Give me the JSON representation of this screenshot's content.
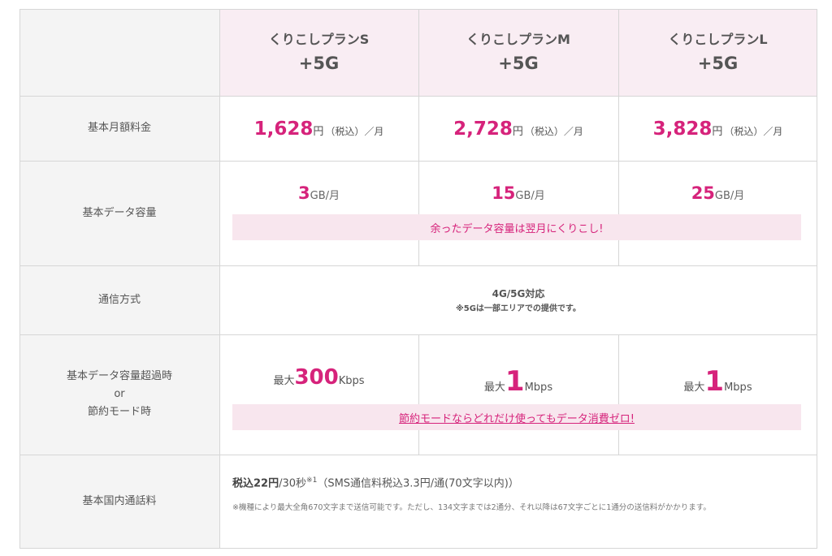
{
  "plans": [
    {
      "name": "くりこしプランS",
      "suffix": "+5G",
      "price": "1,628",
      "data_gb": "3",
      "speed_value": "300",
      "speed_unit": "Kbps"
    },
    {
      "name": "くりこしプランM",
      "suffix": "+5G",
      "price": "2,728",
      "data_gb": "15",
      "speed_value": "1",
      "speed_unit": "Mbps"
    },
    {
      "name": "くりこしプランL",
      "suffix": "+5G",
      "price": "3,828",
      "data_gb": "25",
      "speed_value": "1",
      "speed_unit": "Mbps"
    }
  ],
  "labels": {
    "monthly_fee": "基本月額料金",
    "data_capacity": "基本データ容量",
    "comm_method": "通信方式",
    "over_line1": "基本データ容量超過時",
    "over_line2": "or",
    "over_line3": "節約モード時",
    "call_fee": "基本国内通話料"
  },
  "units": {
    "yen": "円",
    "tax_month": "（税込）／月",
    "gb_month": "GB/月",
    "speed_prefix": "最大"
  },
  "carryover_note": "余ったデータ容量は翌月にくりこし!",
  "comm": {
    "main": "4G/5G対応",
    "note": "※5Gは一部エリアでの提供です。"
  },
  "savings_link": "節約モードならどれだけ使ってもデータ消費ゼロ!",
  "call": {
    "price": "税込22円",
    "per": "/30秒",
    "sup": "※1",
    "sms": "（SMS通信料税込3.3円/通(70文字以内)）",
    "note": "※機種により最大全角670文字まで送信可能です。ただし、134文字までは2通分、それ以降は67文字ごとに1通分の送信料がかかります。"
  }
}
